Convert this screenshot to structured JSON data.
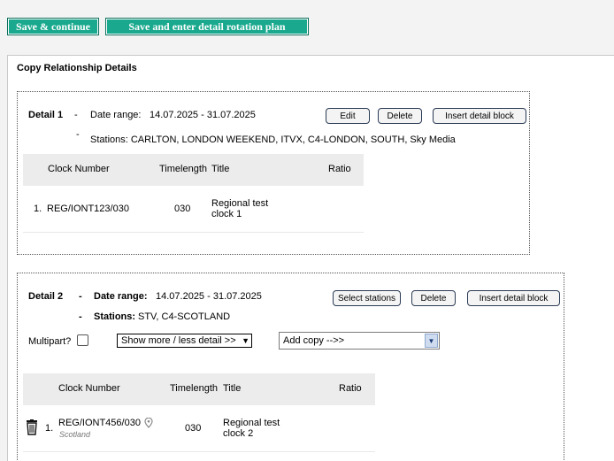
{
  "toolbar": {
    "save_continue": "Save & continue",
    "save_rotation": "Save and enter detail rotation plan"
  },
  "panel": {
    "title": "Copy Relationship Details"
  },
  "detail1": {
    "label": "Detail 1",
    "dash": "-",
    "date_label": "Date range:",
    "date_value": "14.07.2025 - 31.07.2025",
    "stations_dash": "-",
    "stations": "Stations: CARLTON, LONDON WEEKEND, ITVX, C4-LONDON, SOUTH, Sky Media",
    "buttons": {
      "edit": "Edit",
      "delete": "Delete",
      "insert": "Insert detail block"
    },
    "columns": {
      "clock": "Clock Number",
      "time": "Timelength",
      "title": "Title",
      "ratio": "Ratio"
    },
    "rows": [
      {
        "num": "1.",
        "clock": "REG/IONT123/030",
        "time": "030",
        "title_line1": "Regional test",
        "title_line2": "clock 1"
      }
    ]
  },
  "detail2": {
    "label": "Detail 2",
    "dash": "-",
    "date_label": "Date range:",
    "date_value": "14.07.2025 - 31.07.2025",
    "stations_dash": "-",
    "stations_label": "Stations:",
    "stations_value": "STV, C4-SCOTLAND",
    "buttons": {
      "select": "Select stations",
      "delete": "Delete",
      "insert": "Insert detail block"
    },
    "multipart_label": "Multipart?",
    "detail_select": "Show more / less detail >>",
    "add_copy": "Add copy -->>",
    "columns": {
      "clock": "Clock Number",
      "time": "Timelength",
      "title": "Title",
      "ratio": "Ratio"
    },
    "rows": [
      {
        "num": "1.",
        "clock": "REG/IONT456/030",
        "region": "Scotland",
        "time": "030",
        "title_line1": "Regional test",
        "title_line2": "clock 2"
      }
    ]
  }
}
